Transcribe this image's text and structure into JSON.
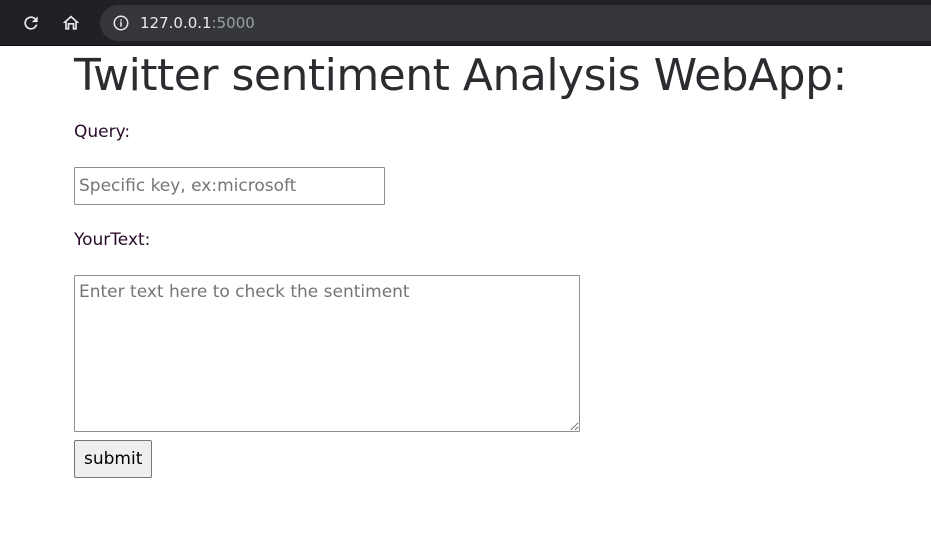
{
  "browser": {
    "url_host": "127.0.0.1",
    "url_port": ":5000",
    "icons": {
      "reload": "reload-icon",
      "home": "home-icon",
      "info": "info-icon"
    }
  },
  "page": {
    "title": "Twitter sentiment Analysis WebApp:",
    "query_label": "Query:",
    "query_placeholder": "Specific key, ex:microsoft",
    "query_value": "",
    "text_label": "YourText:",
    "text_placeholder": "Enter text here to check the sentiment",
    "text_value": "",
    "submit_label": "submit"
  },
  "colors": {
    "toolbar_bg": "#202124",
    "omnibox_bg": "#35363a",
    "title_text": "#2b2b30",
    "label_text": "#2a0a2a"
  }
}
